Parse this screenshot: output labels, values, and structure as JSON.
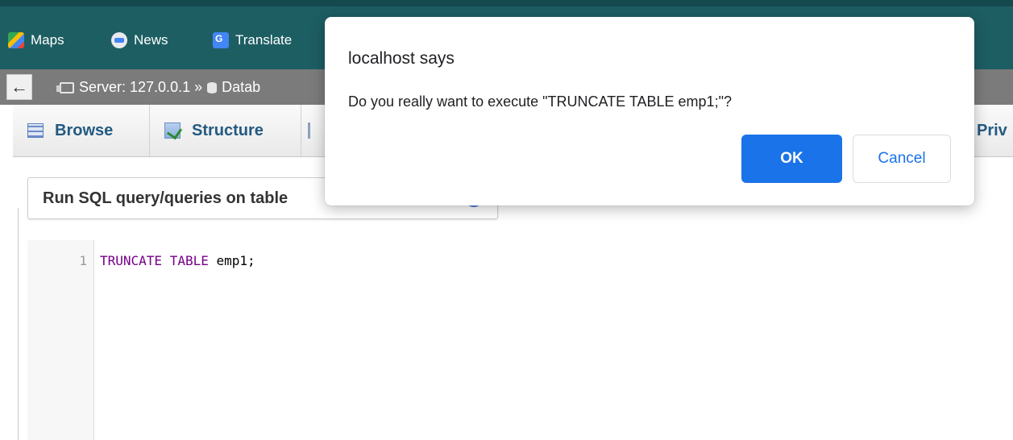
{
  "bookmarks": [
    {
      "label": "Maps",
      "icon": "maps-icon"
    },
    {
      "label": "News",
      "icon": "news-icon"
    },
    {
      "label": "Translate",
      "icon": "translate-icon"
    }
  ],
  "breadcrumb": {
    "server": "Server: 127.0.0.1 »",
    "database": "Datab"
  },
  "tabs": {
    "browse": "Browse",
    "structure": "Structure",
    "privileges_partial": "Priv"
  },
  "query_panel": {
    "title": "Run SQL query/queries on table"
  },
  "editor": {
    "line_number": "1",
    "keyword1": "TRUNCATE",
    "keyword2": "TABLE",
    "identifier": "emp1;"
  },
  "dialog": {
    "title": "localhost says",
    "message": "Do you really want to execute \"TRUNCATE TABLE emp1;\"?",
    "ok_label": "OK",
    "cancel_label": "Cancel"
  },
  "colors": {
    "bookmark_bar": "#1d5e63",
    "crumb_bar": "#7b7b7b",
    "primary_button": "#1a73e8",
    "tab_text": "#235a81",
    "sql_keyword": "#770088"
  }
}
